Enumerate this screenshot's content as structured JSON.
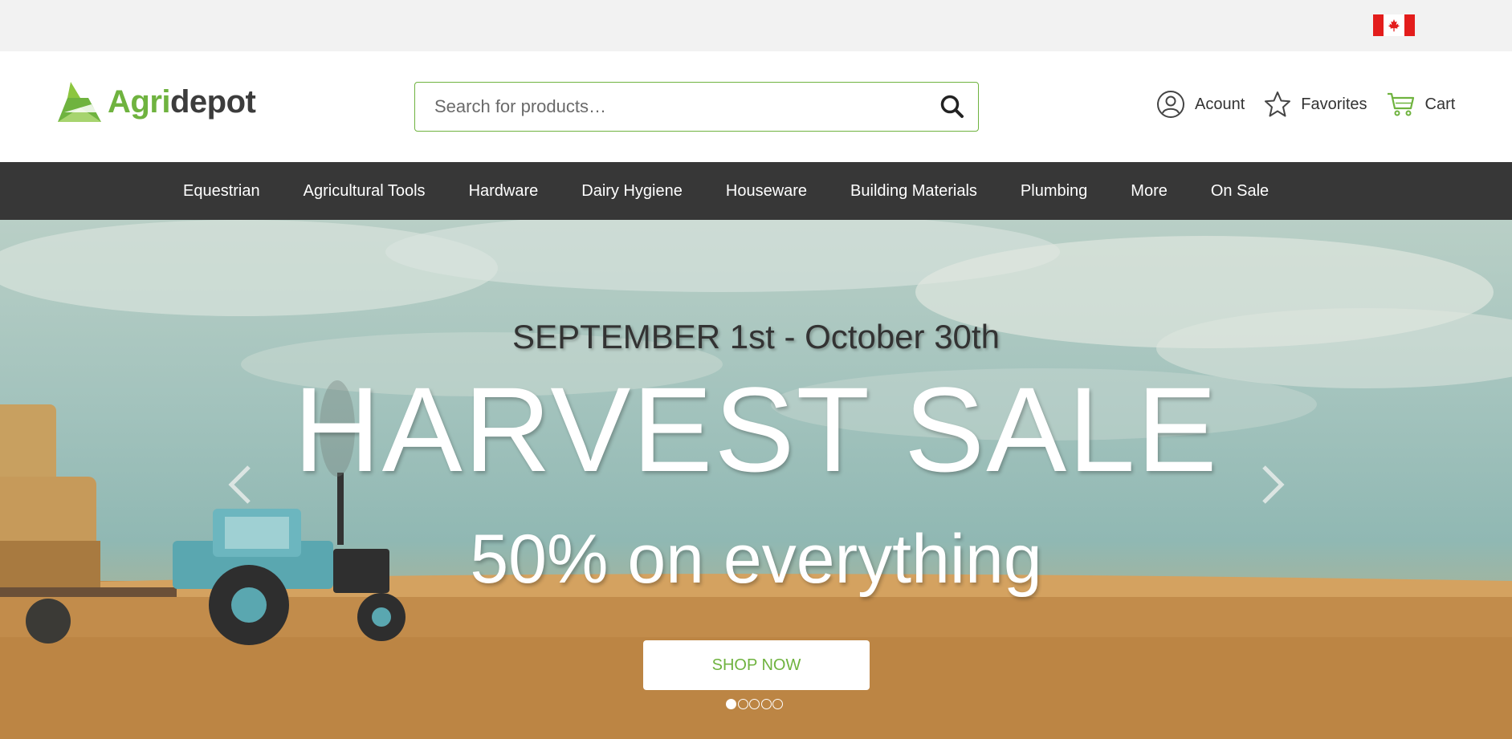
{
  "brand": {
    "logo_part1": "Agri",
    "logo_part2": "depot",
    "accent_color": "#6fb33f"
  },
  "topbar": {
    "flag_icon": "canada-flag-icon"
  },
  "search": {
    "placeholder": "Search for products…",
    "value": ""
  },
  "header_links": {
    "account_label": "Acount",
    "favorites_label": "Favorites",
    "cart_label": "Cart"
  },
  "nav": {
    "items": [
      "Equestrian",
      "Agricultural Tools",
      "Hardware",
      "Dairy Hygiene",
      "Houseware",
      "Building Materials",
      "Plumbing",
      "More",
      "On Sale"
    ]
  },
  "hero": {
    "date": "SEPTEMBER 1st - October 30th",
    "title": "HARVEST SALE",
    "subtitle": "50% on everything",
    "cta_label": "SHOP NOW",
    "slide_count": 5,
    "active_slide": 1
  }
}
